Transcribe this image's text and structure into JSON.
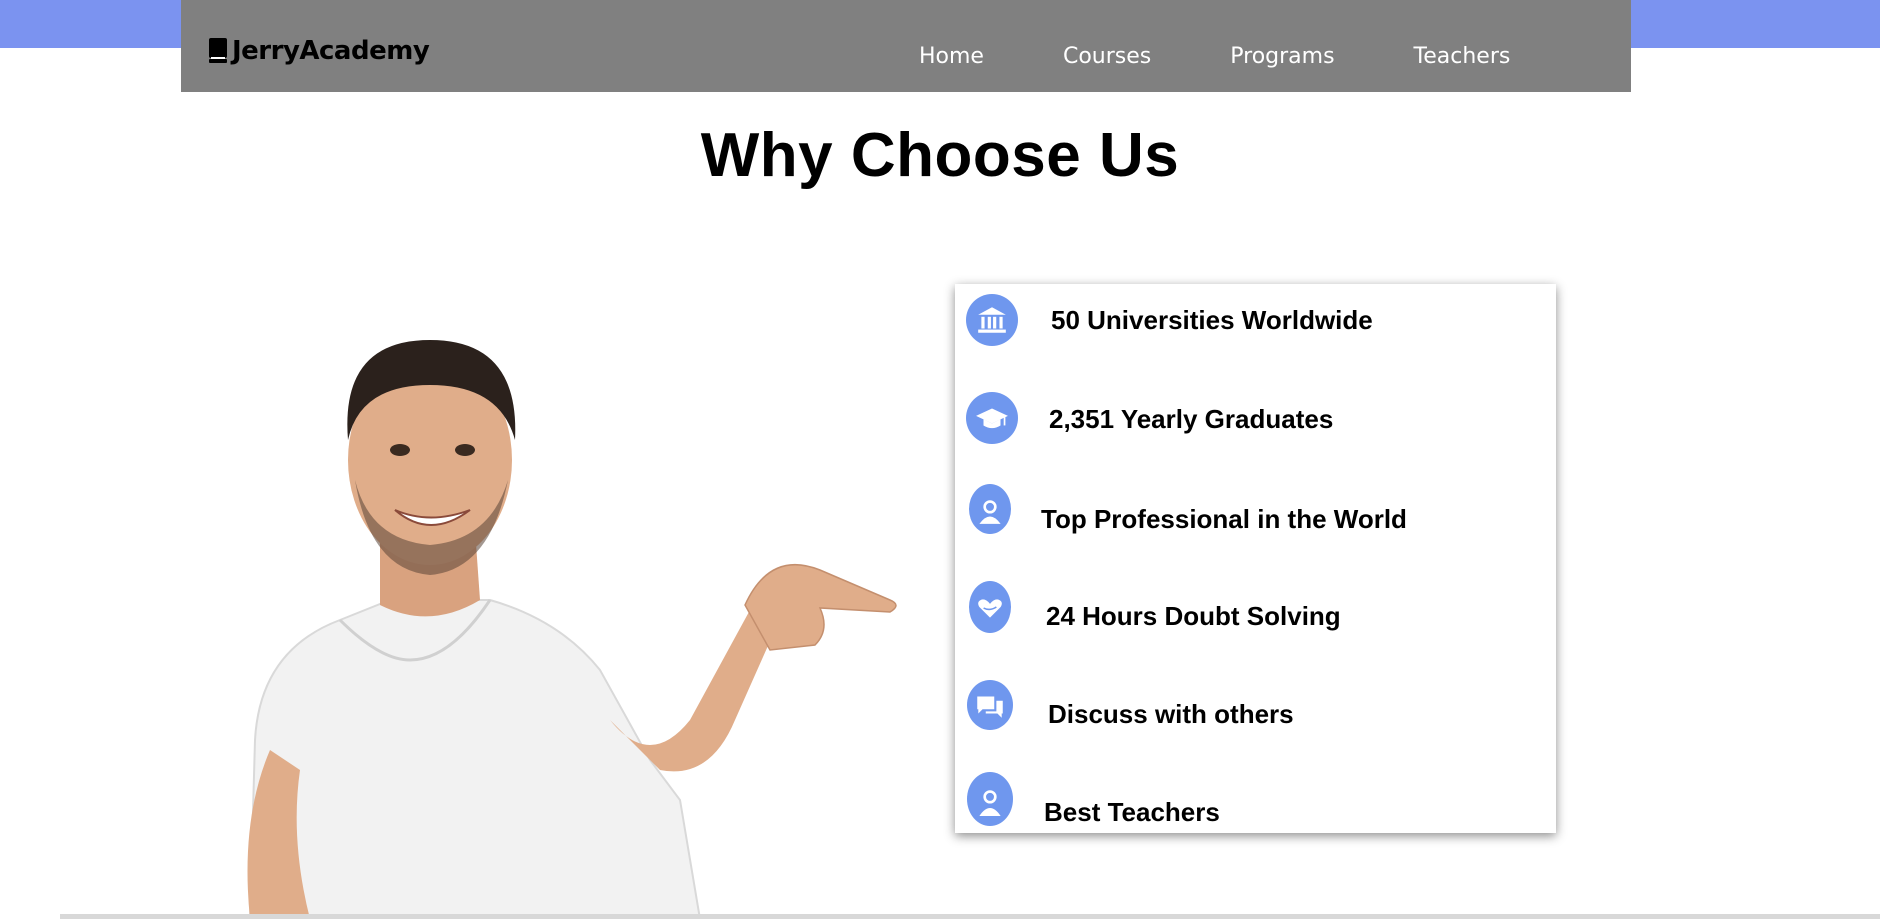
{
  "brand": {
    "name": "JerryAcademy",
    "icon": "book-icon"
  },
  "nav": {
    "items": [
      "Home",
      "Courses",
      "Programs",
      "Teachers"
    ]
  },
  "section": {
    "title": "Why Choose Us"
  },
  "features": [
    {
      "label": "50 Universities Worldwide",
      "icon": "university-icon"
    },
    {
      "label": "2,351 Yearly Graduates",
      "icon": "graduation-cap-icon"
    },
    {
      "label": "Top Professional in the World",
      "icon": "user-icon"
    },
    {
      "label": "24 Hours Doubt Solving",
      "icon": "heart-hand-icon"
    },
    {
      "label": "Discuss with others",
      "icon": "chat-icon"
    },
    {
      "label": "Best Teachers",
      "icon": "user-icon"
    }
  ],
  "colors": {
    "accent": "#6f97ee",
    "top_band": "#7b93f0",
    "navbar": "#808080"
  }
}
